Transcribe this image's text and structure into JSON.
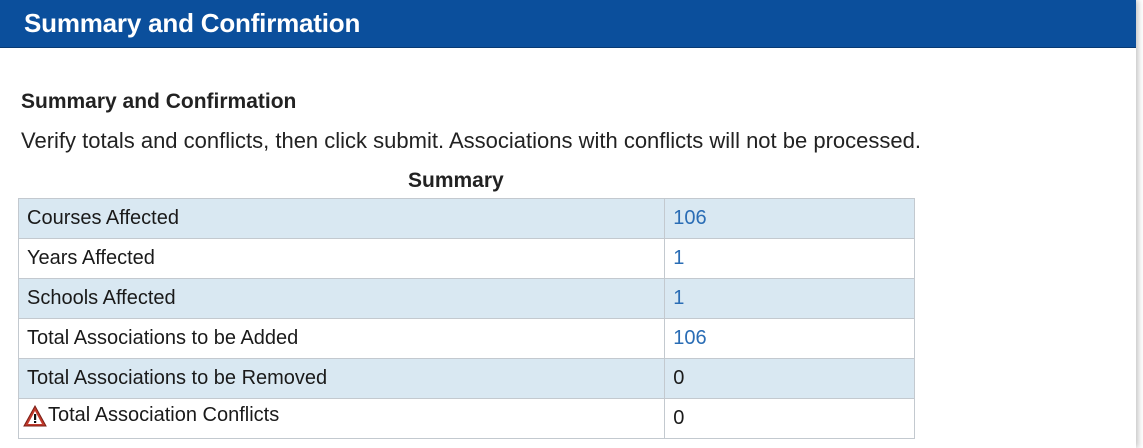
{
  "header": {
    "title": "Summary and Confirmation"
  },
  "section": {
    "title": "Summary and Confirmation",
    "instructions": "Verify totals and conflicts, then click submit. Associations with conflicts will not be processed."
  },
  "summary_table": {
    "caption": "Summary",
    "rows": [
      {
        "label": "Courses Affected",
        "value": "106"
      },
      {
        "label": "Years Affected",
        "value": "1"
      },
      {
        "label": "Schools Affected",
        "value": "1"
      },
      {
        "label": "Total Associations to be Added",
        "value": "106"
      },
      {
        "label": "Total Associations to be Removed",
        "value": "0"
      },
      {
        "label": "Total Association Conflicts",
        "value": "0",
        "icon": "warning-icon"
      }
    ]
  },
  "colors": {
    "header_bg": "#0b4f9c",
    "row_alt_bg": "#d9e8f2",
    "link": "#2a6db5",
    "warning": "#c0392b"
  }
}
